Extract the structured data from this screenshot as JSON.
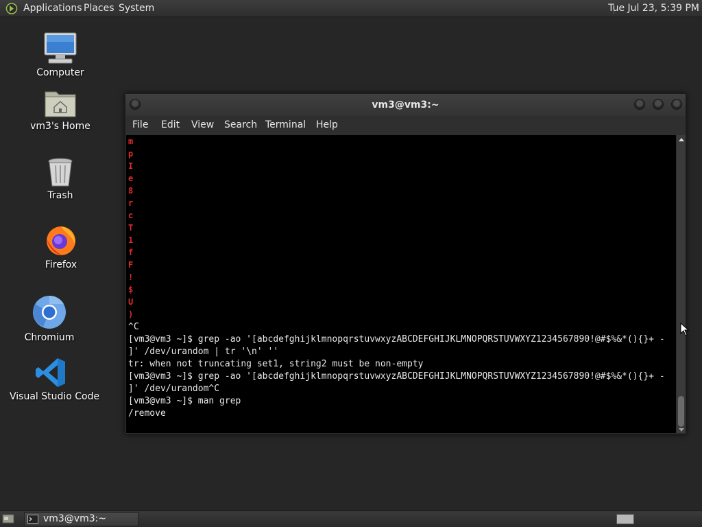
{
  "top_panel": {
    "menus": [
      "Applications",
      "Places",
      "System"
    ],
    "clock": "Tue Jul 23,  5:39 PM"
  },
  "desktop": {
    "icons": [
      {
        "label": "Computer",
        "icon": "computer-icon"
      },
      {
        "label": "vm3's Home",
        "icon": "home-folder-icon"
      },
      {
        "label": "Trash",
        "icon": "trash-icon"
      },
      {
        "label": "Firefox",
        "icon": "firefox-icon"
      },
      {
        "label": "Chromium",
        "icon": "chromium-icon"
      },
      {
        "label": "Visual Studio Code",
        "icon": "vscode-icon"
      }
    ]
  },
  "terminal": {
    "title": "vm3@vm3:~",
    "menu": [
      "File",
      "Edit",
      "View",
      "Search",
      "Terminal",
      "Help"
    ],
    "random_chars": [
      "m",
      "p",
      "I",
      "e",
      "8",
      "r",
      "c",
      "T",
      "1",
      "f",
      "F",
      "!",
      "$",
      "U",
      ")"
    ],
    "lines": [
      "^C",
      "[vm3@vm3 ~]$ grep -ao '[abcdefghijklmnopqrstuvwxyzABCDEFGHIJKLMNOPQRSTUVWXYZ1234567890!@#$%&*(){}+ -",
      "]' /dev/urandom | tr '\\n' ''",
      "tr: when not truncating set1, string2 must be non-empty",
      "[vm3@vm3 ~]$ grep -ao '[abcdefghijklmnopqrstuvwxyzABCDEFGHIJKLMNOPQRSTUVWXYZ1234567890!@#$%&*(){}+ -",
      "]' /dev/urandom^C",
      "[vm3@vm3 ~]$ man grep",
      "/remove"
    ],
    "colors": {
      "random_chars": "#e02a2a",
      "text": "#e8e8e8",
      "background": "#000000"
    }
  },
  "taskbar": {
    "tasks": [
      {
        "label": "vm3@vm3:~",
        "icon": "terminal-icon"
      }
    ]
  }
}
